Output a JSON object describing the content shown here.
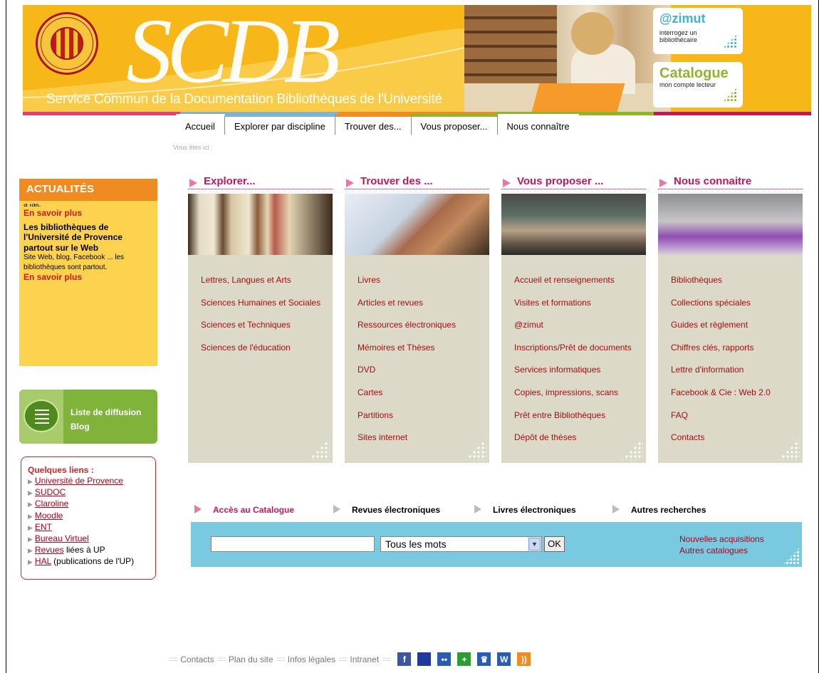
{
  "banner": {
    "logo_text": "SCDB",
    "title": "Service Commun de la Documentation Bibliothèques de l'Université",
    "azimut": {
      "title": "@zimut",
      "subtitle_1": "interrogez un",
      "subtitle_2": "bibliothécaire"
    },
    "catalogue": {
      "title": "Catalogue",
      "subtitle": "mon compte lecteur"
    },
    "stripe_colors": [
      "#e63d7a",
      "#7fb3d6",
      "#f08b22",
      "#8ab82a",
      "#c2185b"
    ]
  },
  "nav": {
    "items": [
      {
        "label": "Accueil",
        "color": "#ffffff"
      },
      {
        "label": "Explorer par discipline",
        "color": "#7fb3d6"
      },
      {
        "label": "Trouver des...",
        "color": "#f08b22"
      },
      {
        "label": "Vous proposer...",
        "color": "#8ab82a"
      },
      {
        "label": "Nous connaître",
        "color": "#ffffff"
      }
    ],
    "breadcrumb": "Vous êtes ici :"
  },
  "news": {
    "header": "ACTUALITÉS",
    "cut_text": "a fait.",
    "more_1": "En savoir plus",
    "headline": "Les bibliothèques de l'Université de Provence partout sur le Web",
    "description": "Site Web, blog, Facebook ... les bibliothèques sont partout.",
    "more_2": "En savoir plus"
  },
  "diffusion": {
    "line_1": "Liste de diffusion",
    "line_2": "Blog"
  },
  "links": {
    "header": "Quelques liens :",
    "items": [
      {
        "link": "Université de Provence",
        "suffix": ""
      },
      {
        "link": "SUDOC",
        "suffix": ""
      },
      {
        "link": "Claroline",
        "suffix": ""
      },
      {
        "link": "Moodle",
        "suffix": ""
      },
      {
        "link": "ENT",
        "suffix": ""
      },
      {
        "link": "Bureau Virtuel",
        "suffix": ""
      },
      {
        "link": "Revues",
        "suffix": " liées à UP"
      },
      {
        "link": "HAL",
        "suffix": " (publications de l'UP)"
      }
    ]
  },
  "columns": [
    {
      "title": "Explorer...",
      "links": [
        "Lettres, Langues et Arts",
        "Sciences Humaines et Sociales",
        "Sciences et Techniques",
        "Sciences de l'éducation"
      ]
    },
    {
      "title": "Trouver des ...",
      "links": [
        "Livres",
        "Articles et revues",
        "Ressources électroniques",
        "Mémoires et Thèses",
        "DVD",
        "Cartes",
        "Partitions",
        "Sites internet"
      ]
    },
    {
      "title": "Vous proposer ...",
      "links": [
        "Accueil et renseignements",
        "Visites et formations",
        "@zimut",
        "Inscriptions/Prêt de documents",
        "Services informatiques",
        "Copies, impressions, scans",
        "Prêt entre Bibliothèques",
        "Dépôt de thèses"
      ]
    },
    {
      "title": "Nous connaitre",
      "links": [
        "Bibliothèques",
        "Collections spéciales",
        "Guides et règlement",
        "Chiffres clés, rapports",
        "Lettre d'information",
        "Facebook & Cie : Web 2.0",
        "FAQ",
        "Contacts"
      ]
    }
  ],
  "catalogue": {
    "tabs": [
      "Accès au Catalogue",
      "Revues électroniques",
      "Livres électroniques",
      "Autres recherches"
    ],
    "search_value": "",
    "select_value": "Tous les mots",
    "ok_label": "OK",
    "right_link_1": "Nouvelles acquisitions",
    "right_link_2": "Autres catalogues"
  },
  "footer": {
    "links": [
      "Contacts",
      "Plan du site",
      "Infos légales",
      "Intranet"
    ],
    "separator": "::::::::::",
    "social": [
      {
        "icon": "facebook-icon",
        "glyph": "f",
        "color": "#3b5998"
      },
      {
        "icon": "delicious-icon",
        "glyph": "",
        "color": "#1f3a9a"
      },
      {
        "icon": "flickr-icon",
        "glyph": "••",
        "color": "#2a5db0"
      },
      {
        "icon": "netvibes-icon",
        "glyph": "+",
        "color": "#2e9b35"
      },
      {
        "icon": "blogger-icon",
        "glyph": "♛",
        "color": "#2a5db0"
      },
      {
        "icon": "wordpress-icon",
        "glyph": "W",
        "color": "#2a5db0"
      },
      {
        "icon": "rss-icon",
        "glyph": "))",
        "color": "#f08b22"
      }
    ]
  }
}
